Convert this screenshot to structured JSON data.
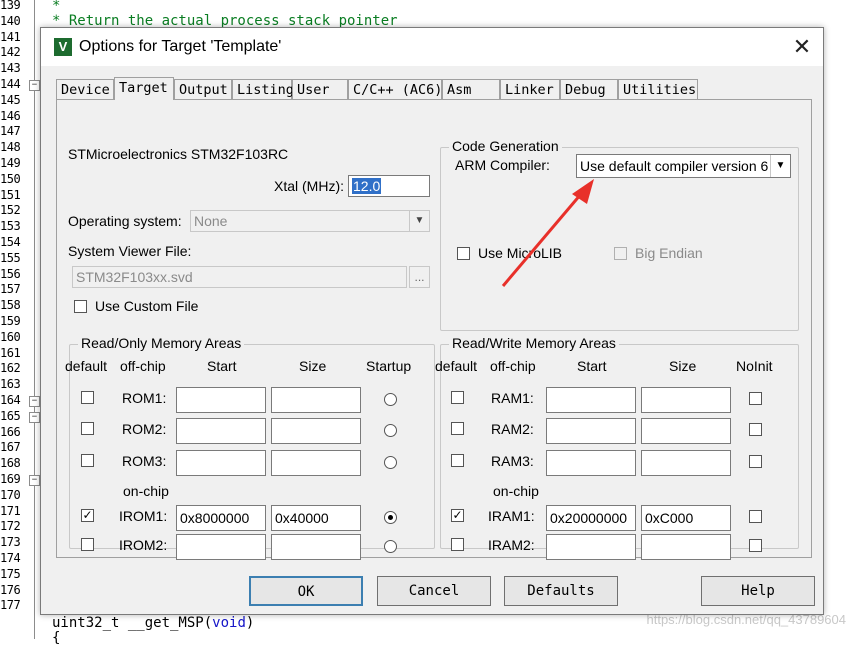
{
  "editor": {
    "line_numbers": [
      "139",
      "140",
      "141",
      "142",
      "143",
      "144",
      "145",
      "146",
      "147",
      "148",
      "149",
      "150",
      "151",
      "152",
      "153",
      "154",
      "155",
      "156",
      "157",
      "158",
      "159",
      "160",
      "161",
      "162",
      "163",
      "164",
      "165",
      "166",
      "167",
      "168",
      "169",
      "170",
      "171",
      "172",
      "173",
      "174",
      "175",
      "176",
      "177"
    ],
    "line1": "*",
    "line2": "* Return the actual process stack pointer",
    "bottom_type": "uint32_t __get_MSP(",
    "bottom_kw": "void",
    "bottom_close": ")",
    "bottom_last": "{",
    "watermark": "https://blog.csdn.net/qq_43789604"
  },
  "dialog": {
    "icon": "V",
    "title": "Options for Target 'Template'",
    "close": "✕",
    "tabs": [
      "Device",
      "Target",
      "Output",
      "Listing",
      "User",
      "C/C++ (AC6)",
      "Asm",
      "Linker",
      "Debug",
      "Utilities"
    ],
    "active_tab": "Target",
    "device_name": "STMicroelectronics STM32F103RC",
    "xtal_label": "Xtal (MHz):",
    "xtal_value": "12.0",
    "os_label": "Operating system:",
    "os_value": "None",
    "svf_label": "System Viewer File:",
    "svf_value": "STM32F103xx.svd",
    "svf_browse": "...",
    "custom_file_label": "Use Custom File",
    "codegen": {
      "title": "Code Generation",
      "compiler_label": "ARM Compiler:",
      "compiler_value": "Use default compiler version 6",
      "microlib_label": "Use MicroLIB",
      "bigendian_label": "Big Endian"
    },
    "ro": {
      "title": "Read/Only Memory Areas",
      "headers": {
        "default": "default",
        "offchip": "off-chip",
        "start": "Start",
        "size": "Size",
        "last": "Startup"
      },
      "onchip": "on-chip",
      "rows": [
        {
          "label": "ROM1:",
          "start": "",
          "size": "",
          "default": false,
          "radio": false
        },
        {
          "label": "ROM2:",
          "start": "",
          "size": "",
          "default": false,
          "radio": false
        },
        {
          "label": "ROM3:",
          "start": "",
          "size": "",
          "default": false,
          "radio": false
        },
        {
          "label": "IROM1:",
          "start": "0x8000000",
          "size": "0x40000",
          "default": true,
          "radio": true
        },
        {
          "label": "IROM2:",
          "start": "",
          "size": "",
          "default": false,
          "radio": false
        }
      ]
    },
    "rw": {
      "title": "Read/Write Memory Areas",
      "headers": {
        "default": "default",
        "offchip": "off-chip",
        "start": "Start",
        "size": "Size",
        "last": "NoInit"
      },
      "onchip": "on-chip",
      "rows": [
        {
          "label": "RAM1:",
          "start": "",
          "size": "",
          "default": false
        },
        {
          "label": "RAM2:",
          "start": "",
          "size": "",
          "default": false
        },
        {
          "label": "RAM3:",
          "start": "",
          "size": "",
          "default": false
        },
        {
          "label": "IRAM1:",
          "start": "0x20000000",
          "size": "0xC000",
          "default": true
        },
        {
          "label": "IRAM2:",
          "start": "",
          "size": "",
          "default": false
        }
      ]
    },
    "buttons": {
      "ok": "OK",
      "cancel": "Cancel",
      "defaults": "Defaults",
      "help": "Help"
    },
    "check_mark": "✓"
  },
  "colors": {
    "arrow": "#e8302a",
    "selection": "#3070c8",
    "comment": "#0a7d22",
    "keyword": "#1515c8"
  }
}
